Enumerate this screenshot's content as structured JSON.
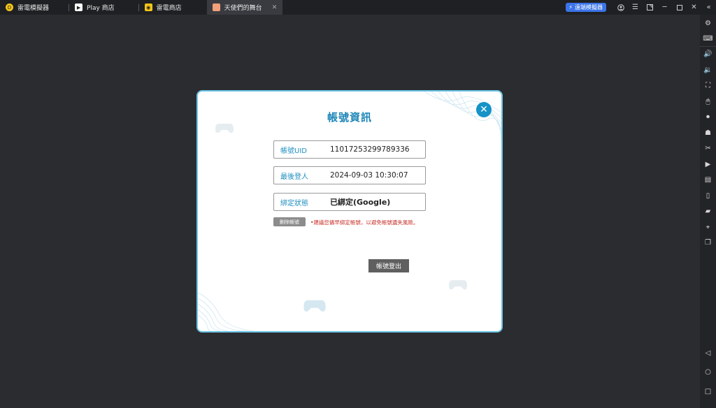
{
  "tabs": [
    {
      "label": "雷電模擬器",
      "icon": "ldplayer-logo-icon",
      "color": "#f5c518"
    },
    {
      "label": "Play 商店",
      "icon": "play-store-icon",
      "color": "#ffffff"
    },
    {
      "label": "雷電商店",
      "icon": "game-store-icon",
      "color": "#f5c518"
    },
    {
      "label": "天使們的舞台",
      "icon": "game-app-icon",
      "color": "#f2a07a",
      "active": true
    }
  ],
  "toolbar": {
    "sync_label": "遠端模擬器"
  },
  "dialog": {
    "title": "帳號資訊",
    "fields": [
      {
        "label": "帳號UID",
        "value": "11017253299789336"
      },
      {
        "label": "最後登人",
        "value": "2024-09-03 10:30:07"
      },
      {
        "label": "綁定狀態",
        "value": "已綁定(Google)"
      }
    ],
    "delete_button": "刪除帳號",
    "warning": "•建議您儘早綁定帳號，以避免帳號遺失風險。",
    "logout_button": "帳號登出"
  },
  "colors": {
    "accent": "#1d86b8",
    "dialog_border": "#6cc4e4",
    "warning": "#c8312a",
    "sync_button": "#3b74e8"
  }
}
